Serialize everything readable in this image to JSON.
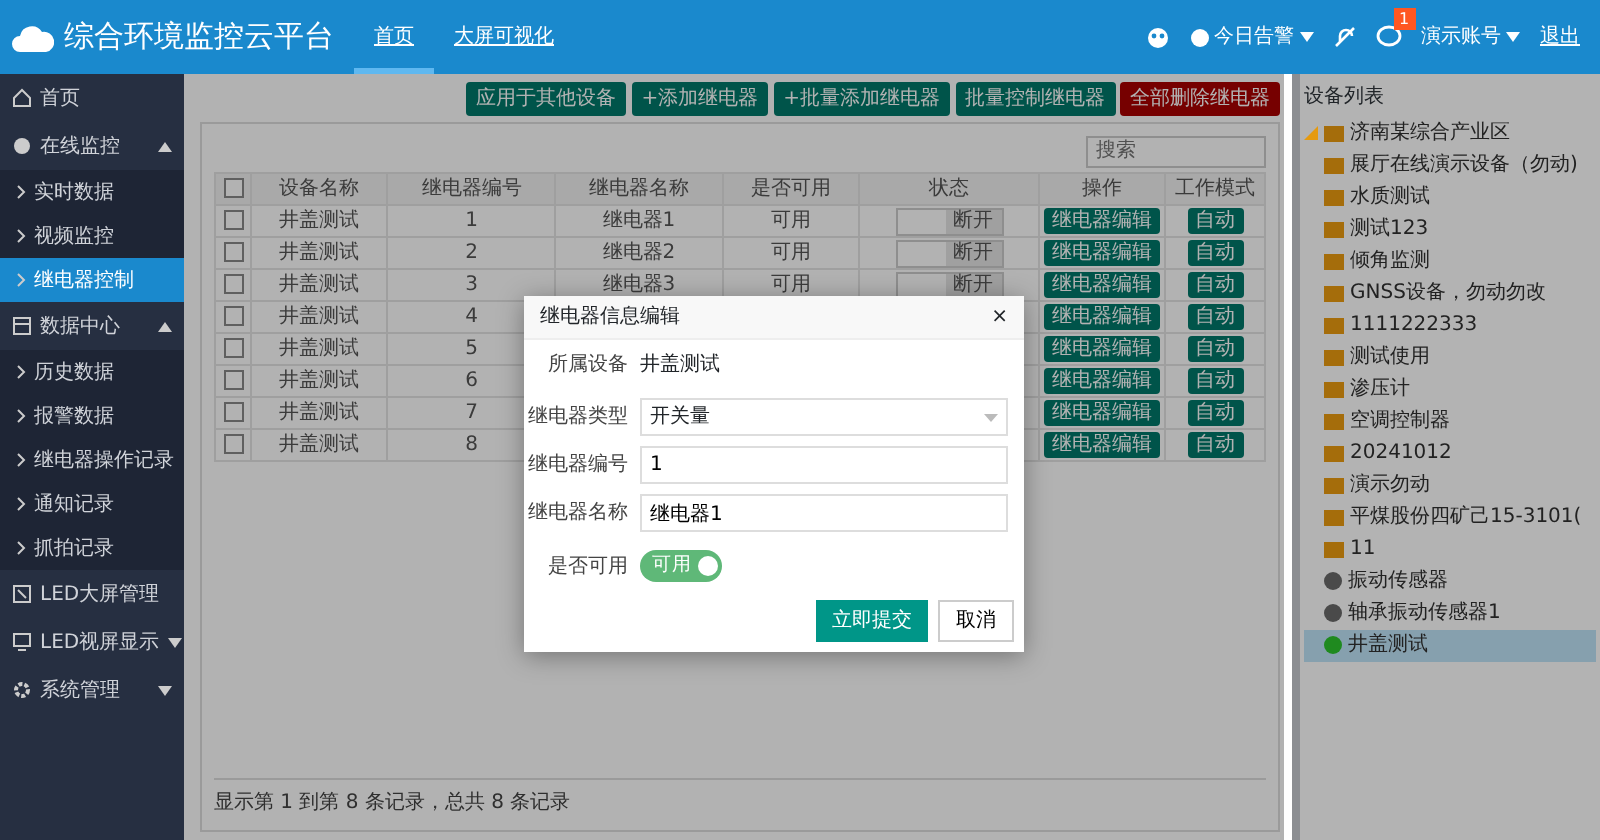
{
  "header": {
    "title": "综合环境监控云平台",
    "nav": [
      {
        "label": "首页",
        "selected": true
      },
      {
        "label": "大屏可视化",
        "selected": false
      }
    ],
    "alerts": "今日告警",
    "notification_count": "1",
    "account": "演示账号",
    "logout": "退出"
  },
  "sidebar": {
    "items": [
      {
        "label": "首页",
        "selected": false
      },
      {
        "label": "在线监控",
        "selected": false,
        "expanded": true,
        "children": [
          {
            "label": "实时数据",
            "selected": false
          },
          {
            "label": "视频监控",
            "selected": false
          },
          {
            "label": "继电器控制",
            "selected": true
          }
        ]
      },
      {
        "label": "数据中心",
        "selected": false,
        "expanded": true,
        "children": [
          {
            "label": "历史数据",
            "selected": false
          },
          {
            "label": "报警数据",
            "selected": false
          },
          {
            "label": "继电器操作记录",
            "selected": false
          },
          {
            "label": "通知记录",
            "selected": false
          },
          {
            "label": "抓拍记录",
            "selected": false
          }
        ]
      },
      {
        "label": "LED大屏管理",
        "selected": false
      },
      {
        "label": "LED视屏显示",
        "selected": false,
        "expanded": false
      },
      {
        "label": "系统管理",
        "selected": false,
        "expanded": false
      }
    ]
  },
  "toolbar": [
    {
      "label": "应用于其他设备",
      "kind": "normal"
    },
    {
      "label": "+添加继电器",
      "kind": "normal"
    },
    {
      "label": "+批量添加继电器",
      "kind": "normal"
    },
    {
      "label": "批量控制继电器",
      "kind": "normal"
    },
    {
      "label": "全部删除继电器",
      "kind": "danger"
    }
  ],
  "search": {
    "placeholder": "搜索"
  },
  "table": {
    "all_checked": false,
    "columns": [
      "设备名称",
      "继电器编号",
      "继电器名称",
      "是否可用",
      "状态",
      "操作",
      "工作模式"
    ],
    "rows": [
      {
        "checked": false,
        "device": "井盖测试",
        "number": "1",
        "name": "继电器1",
        "available": "可用",
        "state": "断开",
        "action": "继电器编辑",
        "mode": "自动"
      },
      {
        "checked": false,
        "device": "井盖测试",
        "number": "2",
        "name": "继电器2",
        "available": "可用",
        "state": "断开",
        "action": "继电器编辑",
        "mode": "自动"
      },
      {
        "checked": false,
        "device": "井盖测试",
        "number": "3",
        "name": "继电器3",
        "available": "可用",
        "state": "断开",
        "action": "继电器编辑",
        "mode": "自动"
      },
      {
        "checked": false,
        "device": "井盖测试",
        "number": "4",
        "action": "继电器编辑",
        "mode": "自动"
      },
      {
        "checked": false,
        "device": "井盖测试",
        "number": "5",
        "action": "继电器编辑",
        "mode": "自动"
      },
      {
        "checked": false,
        "device": "井盖测试",
        "number": "6",
        "action": "继电器编辑",
        "mode": "自动"
      },
      {
        "checked": false,
        "device": "井盖测试",
        "number": "7",
        "action": "继电器编辑",
        "mode": "自动"
      },
      {
        "checked": false,
        "device": "井盖测试",
        "number": "8",
        "action": "继电器编辑",
        "mode": "自动"
      }
    ]
  },
  "footer": "显示第 1 到第 8 条记录，总共 8 条记录",
  "device_tree": {
    "title": "设备列表",
    "nodes": [
      {
        "label": "济南某综合产业区",
        "kind": "folder",
        "expanded": true,
        "selected": false,
        "children": [
          {
            "label": "展厅在线演示设备（勿动)",
            "kind": "folder",
            "selected": false
          },
          {
            "label": "水质测试",
            "kind": "folder",
            "selected": false
          },
          {
            "label": "测试123",
            "kind": "folder",
            "selected": false
          },
          {
            "label": "倾角监测",
            "kind": "folder",
            "selected": false
          },
          {
            "label": "GNSS设备，勿动勿改",
            "kind": "folder",
            "selected": false
          },
          {
            "label": "1111222333",
            "kind": "folder",
            "selected": false
          },
          {
            "label": "测试使用",
            "kind": "folder",
            "selected": false
          },
          {
            "label": "渗压计",
            "kind": "folder",
            "selected": false
          },
          {
            "label": "空调控制器",
            "kind": "folder",
            "selected": false
          },
          {
            "label": "20241012",
            "kind": "folder",
            "selected": false
          },
          {
            "label": "演示勿动",
            "kind": "folder",
            "selected": false
          },
          {
            "label": "平煤股份四矿己15-3101(",
            "kind": "folder",
            "selected": false
          },
          {
            "label": "11",
            "kind": "folder",
            "selected": false
          },
          {
            "label": "振动传感器",
            "kind": "sensor",
            "color": "#4a4a4a",
            "selected": false
          },
          {
            "label": "轴承振动传感器1",
            "kind": "sensor",
            "color": "#4a4a4a",
            "selected": false
          },
          {
            "label": "井盖测试",
            "kind": "sensor",
            "color": "#1f8a1f",
            "selected": true
          }
        ]
      }
    ]
  },
  "dialog": {
    "title": "继电器信息编辑",
    "close": "×",
    "device_label": "所属设备",
    "device_value": "井盖测试",
    "fields": [
      {
        "label": "继电器类型",
        "kind": "select",
        "value": "开关量"
      },
      {
        "label": "继电器编号",
        "kind": "input",
        "value": "1"
      },
      {
        "label": "继电器名称",
        "kind": "input",
        "value": "继电器1"
      },
      {
        "label": "是否可用",
        "kind": "switch",
        "on": true,
        "text": "可用"
      }
    ],
    "submit": "立即提交",
    "cancel": "取消"
  }
}
